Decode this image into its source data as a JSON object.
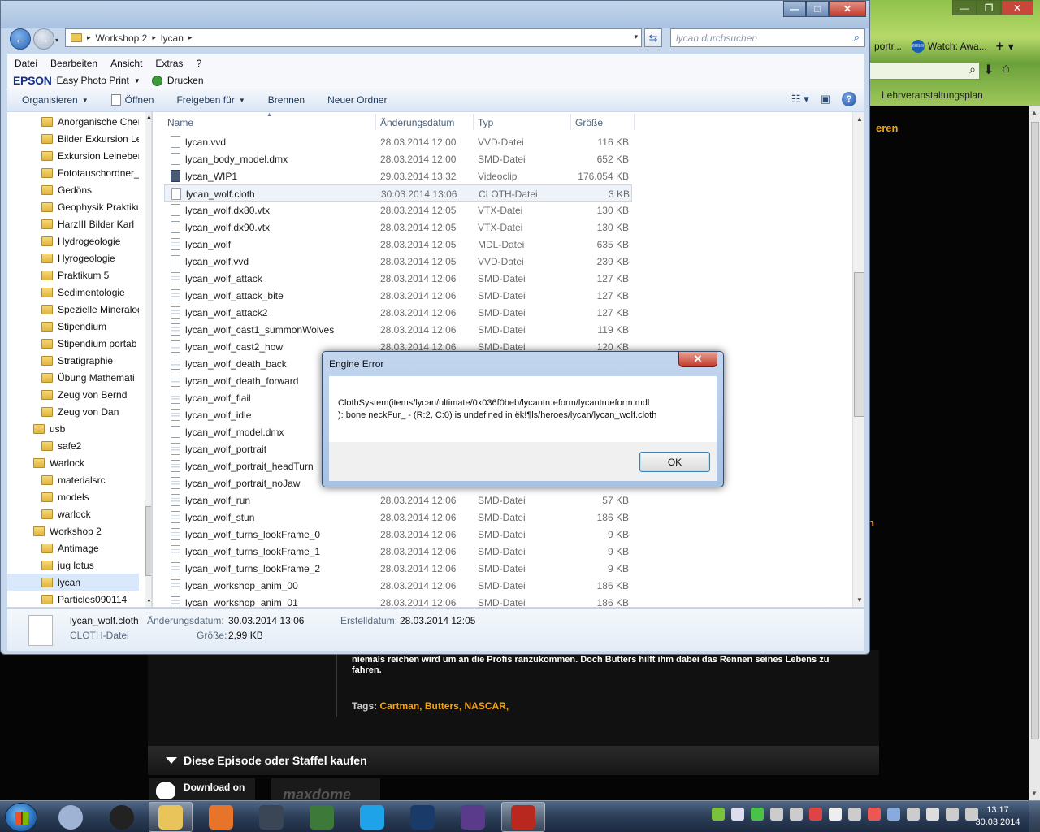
{
  "browser": {
    "tabs": [
      {
        "label": "portr..."
      },
      {
        "label": "Watch: Awa..."
      }
    ],
    "tab_logo_text": "mmm",
    "bookmark": "Lehrveranstaltungsplan",
    "side_text_top": "eren",
    "side_text_mid": "n",
    "description": "niemals reichen wird um an die Profis ranzukommen. Doch Butters hilft ihm dabei das Rennen seines Lebens zu fahren.",
    "tags_label": "Tags:",
    "tags": "Cartman, Butters, NASCAR,",
    "buy_bar": "Diese Episode oder Staffel kaufen",
    "itunes_label": "Download on",
    "maxdome": "maxdome"
  },
  "explorer": {
    "breadcrumb": [
      "Workshop 2",
      "lycan"
    ],
    "search_placeholder": "lycan durchsuchen",
    "menu": [
      "Datei",
      "Bearbeiten",
      "Ansicht",
      "Extras",
      "?"
    ],
    "epson": {
      "brand": "EPSON",
      "app": "Easy Photo Print",
      "print": "Drucken"
    },
    "toolbar": {
      "organize": "Organisieren",
      "open": "Öffnen",
      "share": "Freigeben für",
      "burn": "Brennen",
      "new_folder": "Neuer Ordner"
    },
    "columns": {
      "name": "Name",
      "date": "Änderungsdatum",
      "type": "Typ",
      "size": "Größe"
    },
    "nav_items": [
      {
        "label": "Anorganische Chen",
        "indent": 2
      },
      {
        "label": "Bilder Exkursion Lei",
        "indent": 2
      },
      {
        "label": "Exkursion Leineberg",
        "indent": 2
      },
      {
        "label": "Fototauschordner_",
        "indent": 2
      },
      {
        "label": "Gedöns",
        "indent": 2
      },
      {
        "label": "Geophysik Praktiku",
        "indent": 2
      },
      {
        "label": "HarzIII Bilder Karl",
        "indent": 2
      },
      {
        "label": "Hydrogeologie",
        "indent": 2
      },
      {
        "label": "Hyrogeologie",
        "indent": 2
      },
      {
        "label": "Praktikum 5",
        "indent": 2
      },
      {
        "label": "Sedimentologie",
        "indent": 2
      },
      {
        "label": "Spezielle Mineralog",
        "indent": 2
      },
      {
        "label": "Stipendium",
        "indent": 2
      },
      {
        "label": "Stipendium portab",
        "indent": 2
      },
      {
        "label": "Stratigraphie",
        "indent": 2
      },
      {
        "label": "Übung Mathemati",
        "indent": 2
      },
      {
        "label": "Zeug von Bernd",
        "indent": 2
      },
      {
        "label": "Zeug von Dan",
        "indent": 2
      },
      {
        "label": "usb",
        "indent": 1
      },
      {
        "label": "safe2",
        "indent": 2
      },
      {
        "label": "Warlock",
        "indent": 1
      },
      {
        "label": "materialsrc",
        "indent": 2
      },
      {
        "label": "models",
        "indent": 2
      },
      {
        "label": "warlock",
        "indent": 2
      },
      {
        "label": "Workshop 2",
        "indent": 1
      },
      {
        "label": "Antimage",
        "indent": 2
      },
      {
        "label": "jug lotus",
        "indent": 2
      },
      {
        "label": "lycan",
        "indent": 2,
        "selected": true
      },
      {
        "label": "Particles090114",
        "indent": 2
      }
    ],
    "files": [
      {
        "name": "lycan.vvd",
        "date": "28.03.2014 12:00",
        "type": "VVD-Datei",
        "size": "116 KB",
        "icon": "blank"
      },
      {
        "name": "lycan_body_model.dmx",
        "date": "28.03.2014 12:00",
        "type": "SMD-Datei",
        "size": "652 KB",
        "icon": "blank"
      },
      {
        "name": "lycan_WIP1",
        "date": "29.03.2014 13:32",
        "type": "Videoclip",
        "size": "176.054 KB",
        "icon": "vid"
      },
      {
        "name": "lycan_wolf.cloth",
        "date": "30.03.2014 13:06",
        "type": "CLOTH-Datei",
        "size": "3 KB",
        "icon": "blank",
        "selected": true
      },
      {
        "name": "lycan_wolf.dx80.vtx",
        "date": "28.03.2014 12:05",
        "type": "VTX-Datei",
        "size": "130 KB",
        "icon": "blank"
      },
      {
        "name": "lycan_wolf.dx90.vtx",
        "date": "28.03.2014 12:05",
        "type": "VTX-Datei",
        "size": "130 KB",
        "icon": "blank"
      },
      {
        "name": "lycan_wolf",
        "date": "28.03.2014 12:05",
        "type": "MDL-Datei",
        "size": "635 KB",
        "icon": "smd"
      },
      {
        "name": "lycan_wolf.vvd",
        "date": "28.03.2014 12:05",
        "type": "VVD-Datei",
        "size": "239 KB",
        "icon": "blank"
      },
      {
        "name": "lycan_wolf_attack",
        "date": "28.03.2014 12:06",
        "type": "SMD-Datei",
        "size": "127 KB",
        "icon": "smd"
      },
      {
        "name": "lycan_wolf_attack_bite",
        "date": "28.03.2014 12:06",
        "type": "SMD-Datei",
        "size": "127 KB",
        "icon": "smd"
      },
      {
        "name": "lycan_wolf_attack2",
        "date": "28.03.2014 12:06",
        "type": "SMD-Datei",
        "size": "127 KB",
        "icon": "smd"
      },
      {
        "name": "lycan_wolf_cast1_summonWolves",
        "date": "28.03.2014 12:06",
        "type": "SMD-Datei",
        "size": "119 KB",
        "icon": "smd"
      },
      {
        "name": "lycan_wolf_cast2_howl",
        "date": "28.03.2014 12:06",
        "type": "SMD-Datei",
        "size": "120 KB",
        "icon": "smd"
      },
      {
        "name": "lycan_wolf_death_back",
        "date": "",
        "type": "",
        "size": "",
        "icon": "smd"
      },
      {
        "name": "lycan_wolf_death_forward",
        "date": "",
        "type": "",
        "size": "",
        "icon": "smd"
      },
      {
        "name": "lycan_wolf_flail",
        "date": "",
        "type": "",
        "size": "",
        "icon": "smd"
      },
      {
        "name": "lycan_wolf_idle",
        "date": "",
        "type": "",
        "size": "",
        "icon": "smd"
      },
      {
        "name": "lycan_wolf_model.dmx",
        "date": "",
        "type": "",
        "size": "",
        "icon": "blank"
      },
      {
        "name": "lycan_wolf_portrait",
        "date": "",
        "type": "",
        "size": "",
        "icon": "smd"
      },
      {
        "name": "lycan_wolf_portrait_headTurn",
        "date": "",
        "type": "",
        "size": "",
        "icon": "smd"
      },
      {
        "name": "lycan_wolf_portrait_noJaw",
        "date": "",
        "type": "",
        "size": "",
        "icon": "smd"
      },
      {
        "name": "lycan_wolf_run",
        "date": "28.03.2014 12:06",
        "type": "SMD-Datei",
        "size": "57 KB",
        "icon": "smd"
      },
      {
        "name": "lycan_wolf_stun",
        "date": "28.03.2014 12:06",
        "type": "SMD-Datei",
        "size": "186 KB",
        "icon": "smd"
      },
      {
        "name": "lycan_wolf_turns_lookFrame_0",
        "date": "28.03.2014 12:06",
        "type": "SMD-Datei",
        "size": "9 KB",
        "icon": "smd"
      },
      {
        "name": "lycan_wolf_turns_lookFrame_1",
        "date": "28.03.2014 12:06",
        "type": "SMD-Datei",
        "size": "9 KB",
        "icon": "smd"
      },
      {
        "name": "lycan_wolf_turns_lookFrame_2",
        "date": "28.03.2014 12:06",
        "type": "SMD-Datei",
        "size": "9 KB",
        "icon": "smd"
      },
      {
        "name": "lycan_workshop_anim_00",
        "date": "28.03.2014 12:06",
        "type": "SMD-Datei",
        "size": "186 KB",
        "icon": "smd"
      },
      {
        "name": "lycan_workshop_anim_01",
        "date": "28.03.2014 12:06",
        "type": "SMD-Datei",
        "size": "186 KB",
        "icon": "smd"
      }
    ],
    "details": {
      "filename": "lycan_wolf.cloth",
      "filetype": "CLOTH-Datei",
      "modified_label": "Änderungsdatum:",
      "modified": "30.03.2014 13:06",
      "created_label": "Erstelldatum:",
      "created": "28.03.2014 12:05",
      "size_label": "Größe:",
      "size": "2,99 KB"
    }
  },
  "dialog": {
    "title": "Engine Error",
    "message_line1": "ClothSystem(items/lycan/ultimate/0x036f0beb/lycantrueform/lycantrueform.mdl",
    "message_line2": "): bone neckFur_ - (R:2, C:0) is undefined in ëk!¶ls/heroes/lycan/lycan_wolf.cloth",
    "ok": "OK"
  },
  "taskbar": {
    "time": "13:17",
    "date": "30.03.2014",
    "apps": [
      {
        "name": "explorer",
        "color": "#e8c45a",
        "active": true
      },
      {
        "name": "firefox",
        "color": "#e8742a"
      },
      {
        "name": "steam",
        "color": "#3a4656"
      },
      {
        "name": "task-manager",
        "color": "#3d7a3a"
      },
      {
        "name": "skype",
        "color": "#1fa3e8"
      },
      {
        "name": "hlmv",
        "color": "#1a3a6a"
      },
      {
        "name": "faceposer",
        "color": "#5a3a8a"
      },
      {
        "name": "dota",
        "color": "#b8281e",
        "active": true
      }
    ],
    "pinned": [
      {
        "name": "feather-app",
        "color": "#9fb4d4"
      },
      {
        "name": "steelseries",
        "color": "#222"
      }
    ],
    "tray_colors": [
      "#7ac23a",
      "#dde",
      "#4ac24a",
      "#ccc",
      "#ccc",
      "#d44",
      "#eee",
      "#ccc",
      "#e55",
      "#8ad",
      "#ccc",
      "#ddd",
      "#ccc",
      "#ccc"
    ]
  }
}
